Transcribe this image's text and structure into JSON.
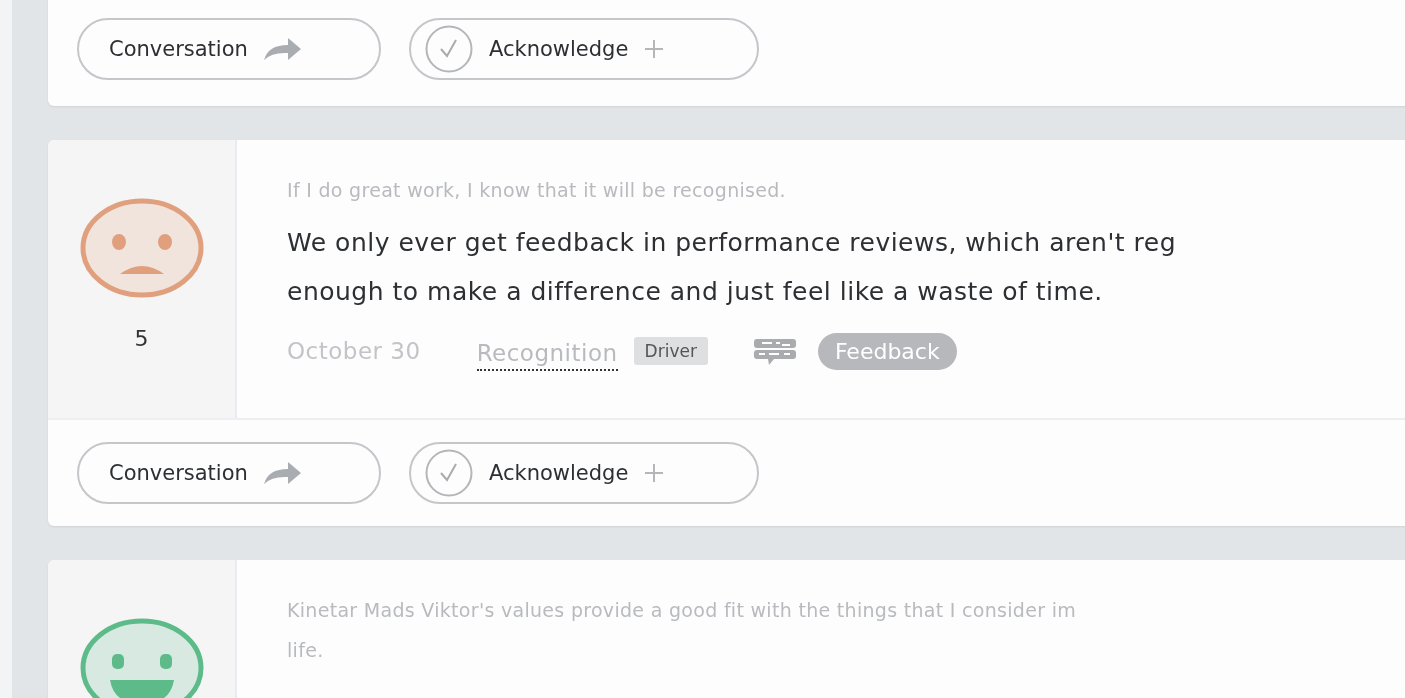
{
  "cards": [
    {
      "footer": {
        "conversation": "Conversation",
        "acknowledge": "Acknowledge"
      }
    },
    {
      "face": {
        "kind": "sad",
        "color": "#e0a07e"
      },
      "score": "5",
      "question": [
        "If I do great work, I know that it will be recognised."
      ],
      "answer": [
        "We only ever get feedback in performance reviews, which aren't reg",
        "enough to make a difference and just feel like a waste of time."
      ],
      "meta": {
        "date": "October 30",
        "driver": "Recognition",
        "driver_tag": "Driver",
        "category": "Feedback"
      },
      "footer": {
        "conversation": "Conversation",
        "acknowledge": "Acknowledge"
      }
    },
    {
      "face": {
        "kind": "happy",
        "color": "#5dbb8a"
      },
      "question": [
        "Kinetar Mads Viktor's values provide a good fit with the things that I consider im",
        "life."
      ]
    }
  ]
}
